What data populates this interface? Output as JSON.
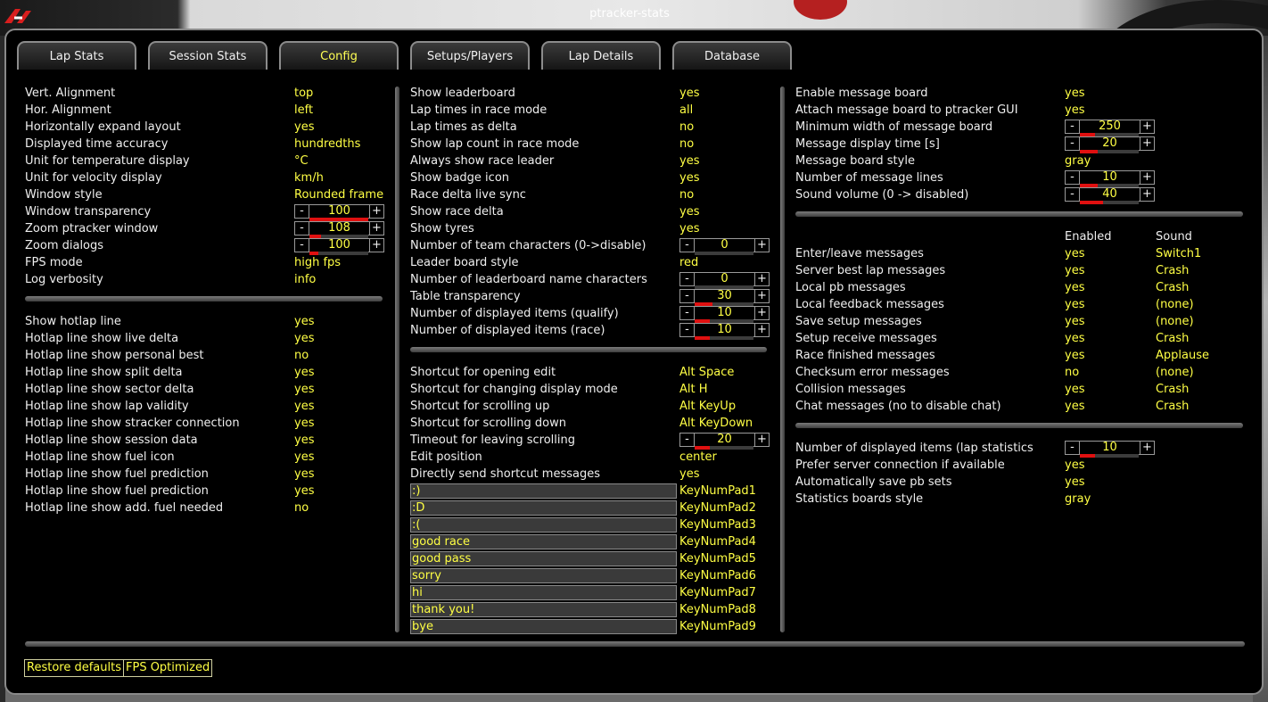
{
  "window": {
    "title": "ptracker-stats"
  },
  "tabs": [
    {
      "label": "Lap Stats",
      "active": false
    },
    {
      "label": "Session Stats",
      "active": false
    },
    {
      "label": "Config",
      "active": true
    },
    {
      "label": "Setups/Players",
      "active": false
    },
    {
      "label": "Lap Details",
      "active": false
    },
    {
      "label": "Database",
      "active": false
    }
  ],
  "colors": {
    "value": "#ffff44",
    "label": "#efefef",
    "slider": "#e01010",
    "background": "#000000"
  },
  "col1": {
    "display": [
      {
        "label": "Vert. Alignment",
        "value": "top"
      },
      {
        "label": "Hor. Alignment",
        "value": "left"
      },
      {
        "label": "Horizontally expand layout",
        "value": "yes"
      },
      {
        "label": "Displayed time accuracy",
        "value": "hundredths"
      },
      {
        "label": "Unit for temperature display",
        "value": "°C"
      },
      {
        "label": "Unit for velocity display",
        "value": "km/h"
      },
      {
        "label": "Window style",
        "value": "Rounded frame"
      },
      {
        "label": "Window transparency",
        "stepper": {
          "value": "100",
          "level": 1.0
        }
      },
      {
        "label": "Zoom ptracker window",
        "stepper": {
          "value": "108",
          "level": 0.2
        }
      },
      {
        "label": "Zoom dialogs",
        "stepper": {
          "value": "100",
          "level": 0.15
        }
      },
      {
        "label": "FPS mode",
        "value": "high fps"
      },
      {
        "label": "Log verbosity",
        "value": "info"
      }
    ],
    "hotlap": [
      {
        "label": "Show hotlap line",
        "value": "yes"
      },
      {
        "label": "Hotlap line show live delta",
        "value": "yes"
      },
      {
        "label": "Hotlap line show personal best",
        "value": "no"
      },
      {
        "label": "Hotlap line show split delta",
        "value": "yes"
      },
      {
        "label": "Hotlap line show sector delta",
        "value": "yes"
      },
      {
        "label": "Hotlap line show lap validity",
        "value": "yes"
      },
      {
        "label": "Hotlap line show stracker connection",
        "value": "yes"
      },
      {
        "label": "Hotlap line show session data",
        "value": "yes"
      },
      {
        "label": "Hotlap line show fuel icon",
        "value": "yes"
      },
      {
        "label": "Hotlap line show fuel prediction",
        "value": "yes"
      },
      {
        "label": "Hotlap line show fuel prediction",
        "value": "yes"
      },
      {
        "label": "Hotlap line show add. fuel needed",
        "value": "no"
      }
    ]
  },
  "col2": {
    "leaderboard": [
      {
        "label": "Show leaderboard",
        "value": "yes"
      },
      {
        "label": "Lap times in race mode",
        "value": "all"
      },
      {
        "label": "Lap times as delta",
        "value": "no"
      },
      {
        "label": "Show lap count in race mode",
        "value": "no"
      },
      {
        "label": "Always show race leader",
        "value": "yes"
      },
      {
        "label": "Show badge icon",
        "value": "yes"
      },
      {
        "label": "Race delta live sync",
        "value": "no"
      },
      {
        "label": "Show race delta",
        "value": "yes"
      },
      {
        "label": "Show tyres",
        "value": "yes"
      },
      {
        "label": "Number of team characters (0->disable)",
        "stepper": {
          "value": "0",
          "level": 0
        }
      },
      {
        "label": "Leader board style",
        "value": "red"
      },
      {
        "label": "Number of leaderboard name characters",
        "stepper": {
          "value": "0",
          "level": 0
        }
      },
      {
        "label": "Table transparency",
        "stepper": {
          "value": "30",
          "level": 0.3
        }
      },
      {
        "label": "Number of displayed items (qualify)",
        "stepper": {
          "value": "10",
          "level": 0.25
        }
      },
      {
        "label": "Number of displayed items (race)",
        "stepper": {
          "value": "10",
          "level": 0.25
        }
      }
    ],
    "shortcuts": [
      {
        "label": "Shortcut for opening edit",
        "value": "Alt Space"
      },
      {
        "label": "Shortcut for changing display mode",
        "value": "Alt H"
      },
      {
        "label": "Shortcut for scrolling up",
        "value": "Alt KeyUp"
      },
      {
        "label": "Shortcut for scrolling down",
        "value": "Alt KeyDown"
      },
      {
        "label": "Timeout for leaving scrolling",
        "stepper": {
          "value": "20",
          "level": 0.25
        }
      },
      {
        "label": "Edit position",
        "value": "center"
      },
      {
        "label": "Directly send shortcut messages",
        "value": "yes"
      }
    ],
    "messages": [
      {
        "text": ":)",
        "key": "KeyNumPad1"
      },
      {
        "text": ":D",
        "key": "KeyNumPad2"
      },
      {
        "text": ":(",
        "key": "KeyNumPad3"
      },
      {
        "text": "good race",
        "key": "KeyNumPad4"
      },
      {
        "text": "good pass",
        "key": "KeyNumPad5"
      },
      {
        "text": "sorry",
        "key": "KeyNumPad6"
      },
      {
        "text": "hi",
        "key": "KeyNumPad7"
      },
      {
        "text": "thank you!",
        "key": "KeyNumPad8"
      },
      {
        "text": "bye",
        "key": "KeyNumPad9"
      }
    ]
  },
  "col3": {
    "board": [
      {
        "label": "Enable message board",
        "value": "yes"
      },
      {
        "label": "Attach message board to ptracker GUI",
        "value": "yes"
      },
      {
        "label": "Minimum width of message board",
        "stepper": {
          "value": "250",
          "level": 0.25
        }
      },
      {
        "label": "Message display time [s]",
        "stepper": {
          "value": "20",
          "level": 0.3
        }
      },
      {
        "label": "Message board style",
        "value": "gray"
      },
      {
        "label": "Number of message lines",
        "stepper": {
          "value": "10",
          "level": 0.3
        }
      },
      {
        "label": "Sound volume (0 -> disabled)",
        "stepper": {
          "value": "40",
          "level": 0.4
        }
      }
    ],
    "msg_header": {
      "enabled": "Enabled",
      "sound": "Sound"
    },
    "msg_types": [
      {
        "label": "Enter/leave messages",
        "enabled": "yes",
        "sound": "Switch1"
      },
      {
        "label": "Server best lap messages",
        "enabled": "yes",
        "sound": "Crash"
      },
      {
        "label": "Local pb messages",
        "enabled": "yes",
        "sound": "Crash"
      },
      {
        "label": "Local feedback messages",
        "enabled": "yes",
        "sound": "(none)"
      },
      {
        "label": "Save setup messages",
        "enabled": "yes",
        "sound": "(none)"
      },
      {
        "label": "Setup receive messages",
        "enabled": "yes",
        "sound": "Crash"
      },
      {
        "label": "Race finished messages",
        "enabled": "yes",
        "sound": "Applause"
      },
      {
        "label": "Checksum error messages",
        "enabled": "no",
        "sound": "(none)"
      },
      {
        "label": "Collision messages",
        "enabled": "yes",
        "sound": "Crash"
      },
      {
        "label": "Chat messages (no to disable chat)",
        "enabled": "yes",
        "sound": "Crash"
      }
    ],
    "stats": [
      {
        "label": "Number of displayed items (lap statistics",
        "stepper": {
          "value": "10",
          "level": 0.25
        }
      },
      {
        "label": "Prefer server connection if available",
        "value": "yes"
      },
      {
        "label": "Automatically save pb sets",
        "value": "yes"
      },
      {
        "label": "Statistics boards style",
        "value": "gray"
      }
    ]
  },
  "footer": {
    "restore_label": "Restore defaults",
    "fps_label": "FPS Optimized"
  }
}
